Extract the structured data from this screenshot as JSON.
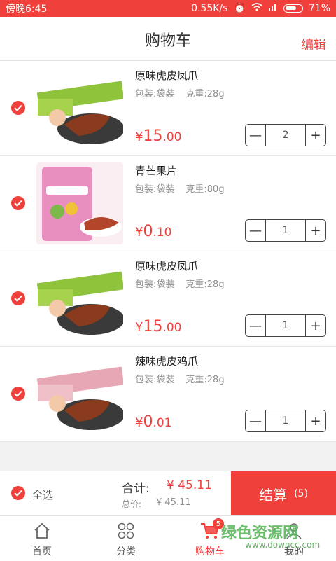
{
  "status_bar": {
    "time": "傍晚6:45",
    "speed": "0.55K/s",
    "battery": "71%"
  },
  "header": {
    "title": "购物车",
    "edit": "编辑"
  },
  "items": [
    {
      "name": "原味虎皮凤爪",
      "pack": "包装:袋装",
      "weight": "克重:28g",
      "price_currency": "¥",
      "price_int": "15",
      "price_dec": ".00",
      "qty": "2"
    },
    {
      "name": "青芒果片",
      "pack": "包装:袋装",
      "weight": "克重:80g",
      "price_currency": "¥",
      "price_int": "0",
      "price_dec": ".10",
      "qty": "1"
    },
    {
      "name": "原味虎皮凤爪",
      "pack": "包装:袋装",
      "weight": "克重:28g",
      "price_currency": "¥",
      "price_int": "15",
      "price_dec": ".00",
      "qty": "1"
    },
    {
      "name": "辣味虎皮鸡爪",
      "pack": "包装:袋装",
      "weight": "克重:28g",
      "price_currency": "¥",
      "price_int": "0",
      "price_dec": ".01",
      "qty": "1"
    }
  ],
  "stepper": {
    "minus": "—",
    "plus": "+"
  },
  "footer": {
    "select_all": "全选",
    "total_label": "合计:",
    "total_value": "¥ 45.11",
    "sum_label": "总价:",
    "sum_value": "¥ 45.11",
    "checkout_label": "结算",
    "checkout_count": "(5)"
  },
  "tabs": [
    {
      "label": "首页"
    },
    {
      "label": "分类"
    },
    {
      "label": "购物车",
      "badge": "5"
    },
    {
      "label": "我的"
    }
  ],
  "watermark": {
    "text": "绿色资源网",
    "url": "www.downcc.com"
  },
  "colors": {
    "accent": "#f0403c",
    "muted": "#8e8e8e"
  }
}
